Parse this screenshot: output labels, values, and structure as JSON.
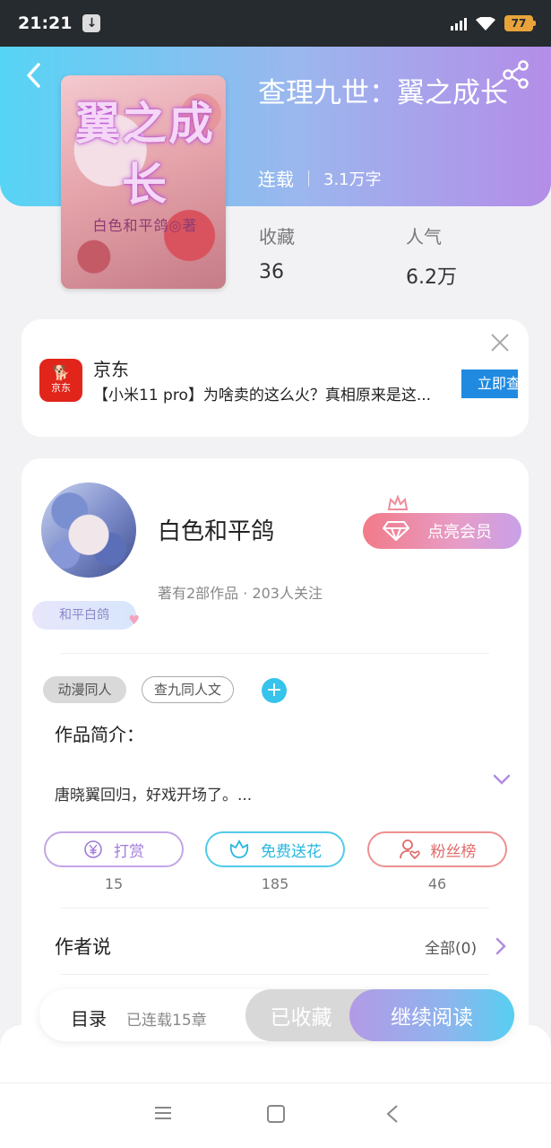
{
  "status_bar": {
    "time": "21:21",
    "battery": "77"
  },
  "book": {
    "title": "查理九世：翼之成长",
    "status": "连载",
    "word_count": "3.1万字",
    "cover": {
      "title_text": "翼之成长",
      "subtitle_text": "白色和平鸽◎著"
    },
    "stats": [
      {
        "label": "收藏",
        "value": "36"
      },
      {
        "label": "人气",
        "value": "6.2万"
      }
    ]
  },
  "ad": {
    "logo_text": "京东",
    "brand": "京东",
    "text": "【小米11 pro】为啥卖的这么火？真相原来是这...",
    "cta": "立即查看"
  },
  "author": {
    "name": "白色和平鸽",
    "badge": "和平白鸽",
    "info": "著有2部作品 · 203人关注",
    "vip_label": "点亮会员"
  },
  "tags": [
    "动漫同人",
    "查九同人文"
  ],
  "tag_add": "+",
  "intro": {
    "title": "作品简介：",
    "text": "唐晓翼回归，好戏开场了。..."
  },
  "actions": [
    {
      "label": "打赏",
      "count": "15",
      "icon": "yen-icon",
      "color": "#a27bd9"
    },
    {
      "label": "免费送花",
      "count": "185",
      "icon": "flower-icon",
      "color": "#28b7df"
    },
    {
      "label": "粉丝榜",
      "count": "46",
      "icon": "fans-icon",
      "color": "#e06a6a"
    }
  ],
  "author_says": {
    "title": "作者说",
    "all_label": "全部(0)"
  },
  "bottom_bar": {
    "toc_label": "目录",
    "toc_count": "已连载15章",
    "collected_label": "已收藏",
    "read_label": "继续阅读"
  },
  "colors": {
    "header_gradient_start": "#56d4f5",
    "header_gradient_end": "#b48de8",
    "ad_logo": "#e1251b",
    "cta_blue": "#1f8ae0",
    "tag_add": "#36c3ec"
  }
}
